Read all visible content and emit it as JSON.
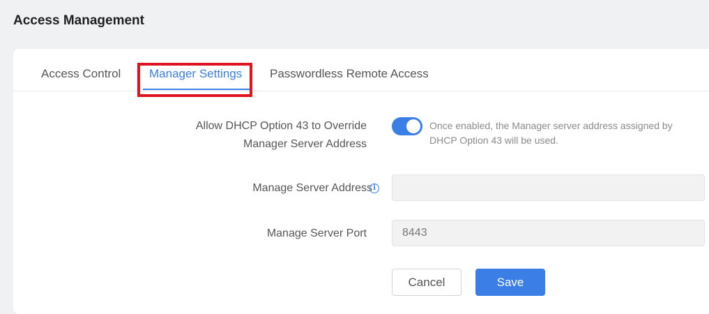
{
  "page": {
    "title": "Access Management"
  },
  "tabs": [
    {
      "label": "Access Control",
      "active": false
    },
    {
      "label": "Manager Settings",
      "active": true
    },
    {
      "label": "Passwordless Remote Access",
      "active": false
    }
  ],
  "form": {
    "dhcp_option": {
      "label_line1": "Allow DHCP Option 43 to Override",
      "label_line2": "Manager Server Address",
      "enabled": true,
      "hint": "Once enabled, the Manager server address assigned by DHCP Option 43 will be used."
    },
    "server_address": {
      "label": "Manage Server Address",
      "value": "",
      "info_icon": "info-circle-icon"
    },
    "server_port": {
      "label": "Manage Server Port",
      "value": "8443"
    }
  },
  "actions": {
    "cancel_label": "Cancel",
    "save_label": "Save"
  },
  "colors": {
    "accent": "#3a7ee6",
    "highlight": "#e0141e"
  }
}
